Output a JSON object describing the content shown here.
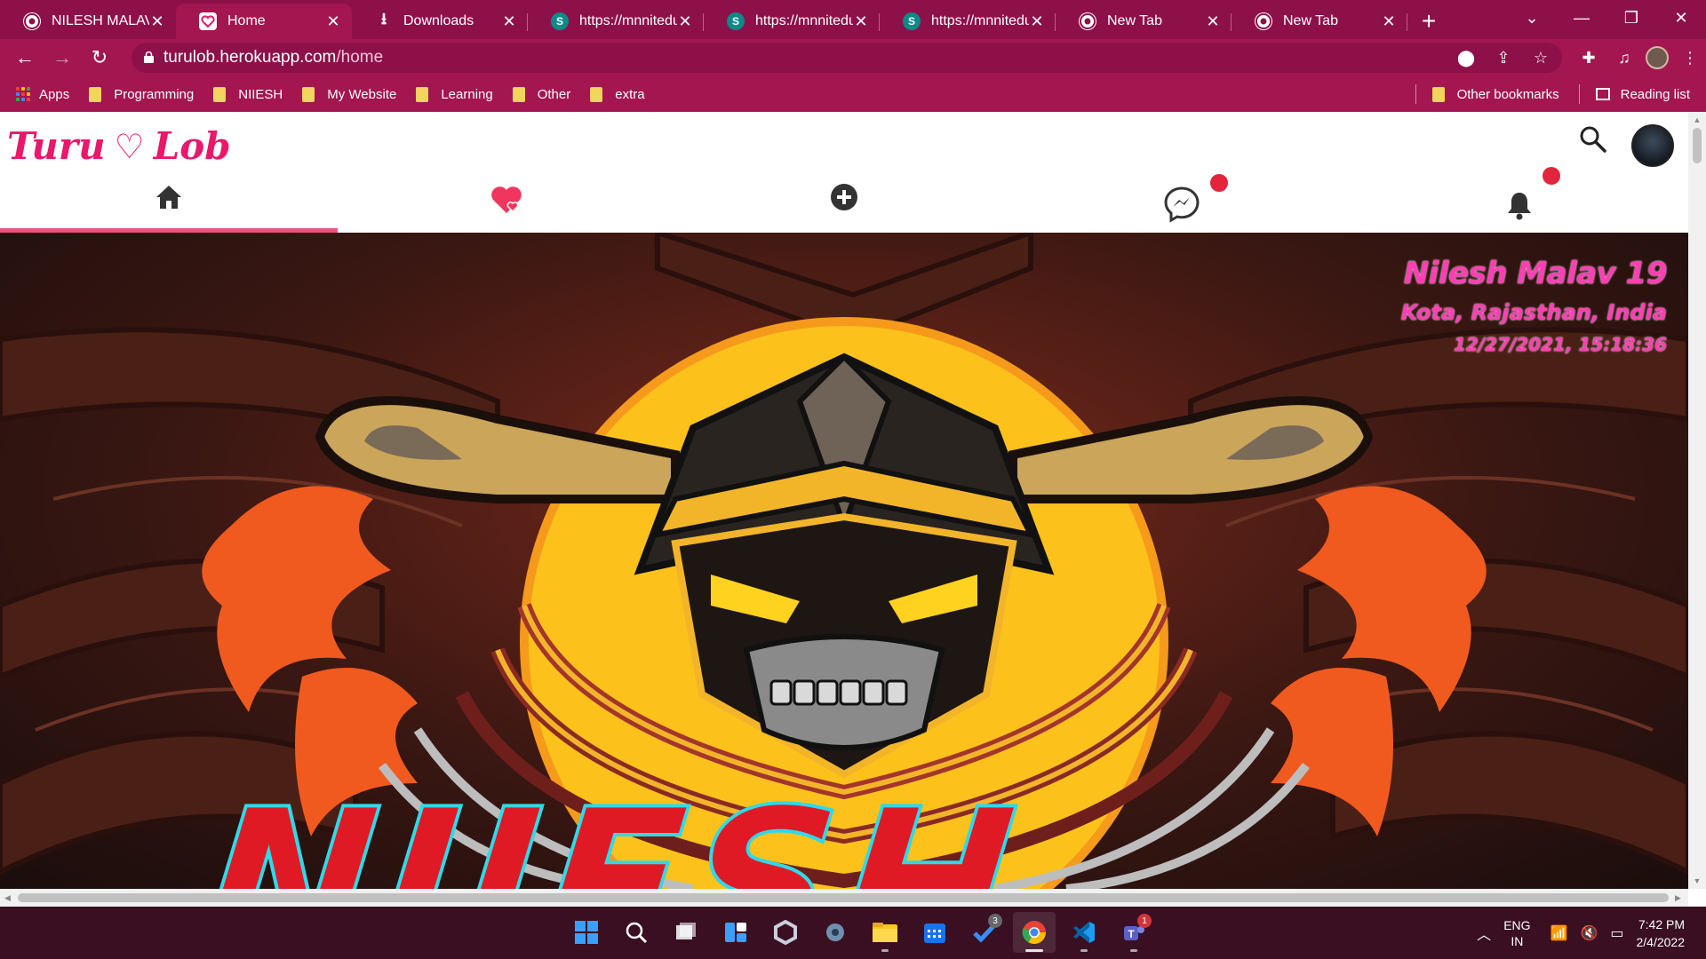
{
  "browser": {
    "tabs": [
      {
        "title": "NILESH MALAV",
        "favicon": "chrome-icon",
        "active": false
      },
      {
        "title": "Home",
        "favicon": "heart-favicon",
        "active": true
      },
      {
        "title": "Downloads",
        "favicon": "download-icon",
        "active": false
      },
      {
        "title": "https://mnnitedu",
        "favicon": "sharepoint-icon",
        "active": false
      },
      {
        "title": "https://mnnitedu",
        "favicon": "sharepoint-icon",
        "active": false
      },
      {
        "title": "https://mnnitedu",
        "favicon": "sharepoint-icon",
        "active": false
      },
      {
        "title": "New Tab",
        "favicon": "chrome-icon",
        "active": false
      },
      {
        "title": "New Tab",
        "favicon": "chrome-icon",
        "active": false
      }
    ],
    "url_host": "turulob.herokuapp.com",
    "url_path": "/home",
    "bookmarks": [
      "Apps",
      "Programming",
      "NIIESH",
      "My Website",
      "Learning",
      "Other",
      "extra"
    ],
    "other_bookmarks": "Other bookmarks",
    "reading_list": "Reading list",
    "theme_color": "#a3164f",
    "tabstrip_color": "#8e1049"
  },
  "app": {
    "logo_left": "Turu",
    "logo_heart": "♡",
    "logo_right": "Lob",
    "accent_color": "#e8186b",
    "nav": [
      {
        "name": "home",
        "icon": "home-icon",
        "active": true
      },
      {
        "name": "likes",
        "icon": "heart-icon",
        "active": false
      },
      {
        "name": "create",
        "icon": "plus-circle-icon",
        "active": false
      },
      {
        "name": "messages",
        "icon": "messenger-icon",
        "active": false,
        "badge": true
      },
      {
        "name": "notifications",
        "icon": "bell-icon",
        "active": false,
        "badge": true
      }
    ]
  },
  "hero": {
    "name": "Nilesh Malav 19",
    "location": "Kota, Rajasthan, India",
    "timestamp": "12/27/2021, 15:18:36",
    "banner_text": "NIIESH",
    "name_color": "#ff3fb4"
  },
  "taskbar": {
    "apps": [
      "start-icon",
      "search-icon",
      "task-view-icon",
      "widgets-icon",
      "office-icon",
      "settings-icon",
      "file-explorer-icon",
      "calendar-icon",
      "todo-icon",
      "chrome-icon",
      "vscode-icon",
      "teams-icon"
    ],
    "todo_badge": "3",
    "teams_badge": "1",
    "lang_top": "ENG",
    "lang_bottom": "IN",
    "time": "7:42 PM",
    "date": "2/4/2022"
  }
}
